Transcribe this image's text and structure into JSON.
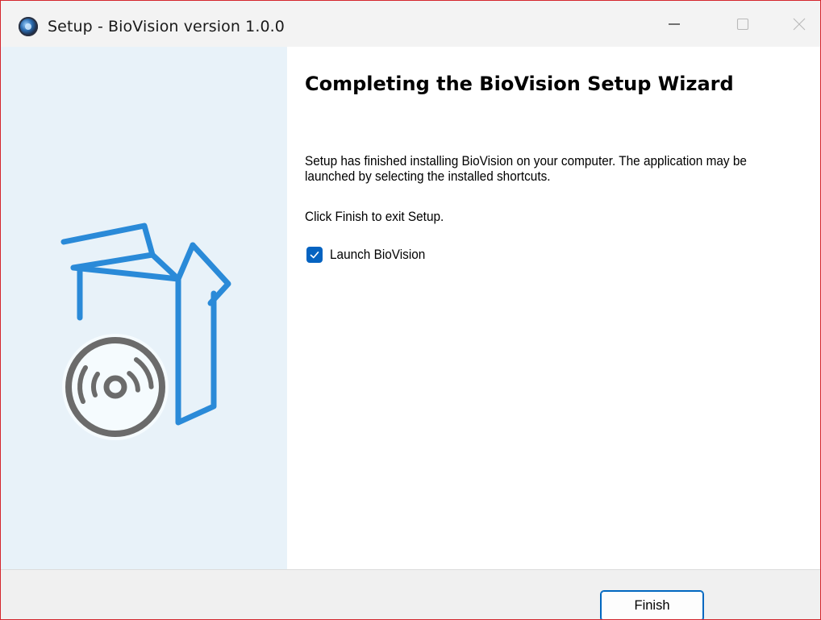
{
  "window": {
    "title": "Setup - BioVision version 1.0.0",
    "app_icon": "biovision-app-icon"
  },
  "controls": {
    "minimize_icon": "minimize-icon",
    "maximize_icon": "maximize-icon",
    "close_icon": "close-icon"
  },
  "side_panel": {
    "illustration": "software-box-with-disc-icon",
    "colors": {
      "background": "#e8f2f9",
      "box_stroke": "#2a8ad8",
      "disc_stroke": "#6b6b6b"
    }
  },
  "content": {
    "heading": "Completing the BioVision Setup Wizard",
    "message": "Setup has finished installing BioVision on your computer. The application may be launched by selecting the installed shortcuts.",
    "exit_hint": "Click Finish to exit Setup.",
    "launch_checkbox": {
      "label": "Launch BioVision",
      "checked": true,
      "color": "#0563c1"
    }
  },
  "footer": {
    "finish_label": "Finish",
    "accent": "#0067c0"
  }
}
